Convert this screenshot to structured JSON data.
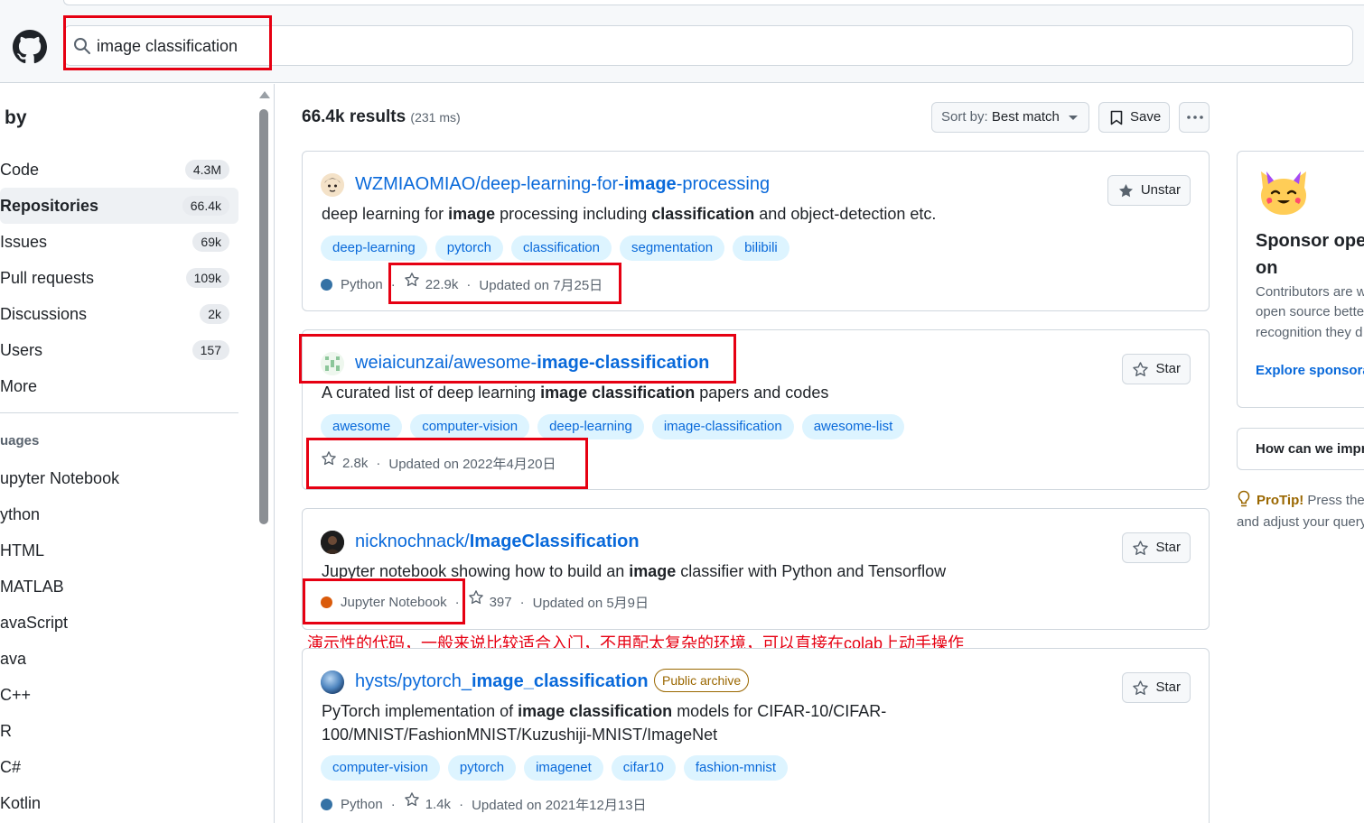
{
  "search": {
    "query": "image classification"
  },
  "sidebar": {
    "filter_title": "by",
    "types": [
      {
        "label": "Code",
        "count": "4.3M"
      },
      {
        "label": "Repositories",
        "count": "66.4k"
      },
      {
        "label": "Issues",
        "count": "69k"
      },
      {
        "label": "Pull requests",
        "count": "109k"
      },
      {
        "label": "Discussions",
        "count": "2k"
      },
      {
        "label": "Users",
        "count": "157"
      },
      {
        "label": "More",
        "count": ""
      }
    ],
    "languages_title": "uages",
    "languages": [
      "upyter Notebook",
      "ython",
      "HTML",
      "MATLAB",
      "avaScript",
      "ava",
      "C++",
      "R",
      "C#",
      "Kotlin"
    ]
  },
  "results": {
    "count": "66.4k results",
    "time": "(231 ms)",
    "sort_prefix": "Sort by:",
    "sort_value": "Best match",
    "save_label": "Save"
  },
  "repos": [
    {
      "owner": "WZMIAOMIAO/",
      "name_parts": [
        "deep-learning-for-",
        "image",
        "-processing"
      ],
      "description_parts": [
        "deep learning for ",
        "image",
        " processing including ",
        "classification",
        " and object-detection etc."
      ],
      "topics": [
        "deep-learning",
        "pytorch",
        "classification",
        "segmentation",
        "bilibili"
      ],
      "language": "Python",
      "language_color": "#3572A5",
      "stars": "22.9k",
      "updated": "Updated on 7月25日",
      "star_button": "Unstar"
    },
    {
      "owner": "weiaicunzai/",
      "name_parts": [
        "awesome-",
        "image-classification"
      ],
      "description_parts": [
        "A curated list of deep learning ",
        "image classification",
        " papers and codes"
      ],
      "topics": [
        "awesome",
        "computer-vision",
        "deep-learning",
        "image-classification",
        "awesome-list"
      ],
      "stars": "2.8k",
      "updated": "Updated on 2022年4月20日",
      "star_button": "Star"
    },
    {
      "owner": "nicknochnack/",
      "name_parts": [
        "ImageClassification"
      ],
      "description_parts": [
        "Jupyter notebook showing how to build an ",
        "image",
        " classifier with Python and Tensorflow"
      ],
      "language": "Jupyter Notebook",
      "language_color": "#DA5B0B",
      "stars": "397",
      "updated": "Updated on 5月9日",
      "star_button": "Star"
    },
    {
      "owner": "hysts/",
      "name_parts": [
        "pytorch_",
        "image_classification"
      ],
      "badge": "Public archive",
      "description_parts": [
        "PyTorch implementation of ",
        "image classification",
        " models for CIFAR-10/CIFAR-100/MNIST/FashionMNIST/Kuzushiji-MNIST/ImageNet"
      ],
      "topics": [
        "computer-vision",
        "pytorch",
        "imagenet",
        "cifar10",
        "fashion-mnist"
      ],
      "language": "Python",
      "language_color": "#3572A5",
      "stars": "1.4k",
      "updated": "Updated on 2021年12月13日",
      "star_button": "Star"
    }
  ],
  "annotation": "演示性的代码，一般来说比较适合入门，不用配太复杂的环境，可以直接在colab上动手操作",
  "right": {
    "sponsor_title_1": "Sponsor oper",
    "sponsor_title_2": "on",
    "sponsor_lines": [
      "Contributors are w",
      "open source bette",
      "recognition they d"
    ],
    "sponsor_link": "Explore sponsoral",
    "feedback": "How can we impro",
    "protip_label": "ProTip!",
    "protip_text_1": " Press the",
    "protip_text_2": "and adjust your query"
  },
  "colors": {
    "accent": "#0969da",
    "annotation_red": "#e60012",
    "topic_bg": "#ddf4ff"
  }
}
